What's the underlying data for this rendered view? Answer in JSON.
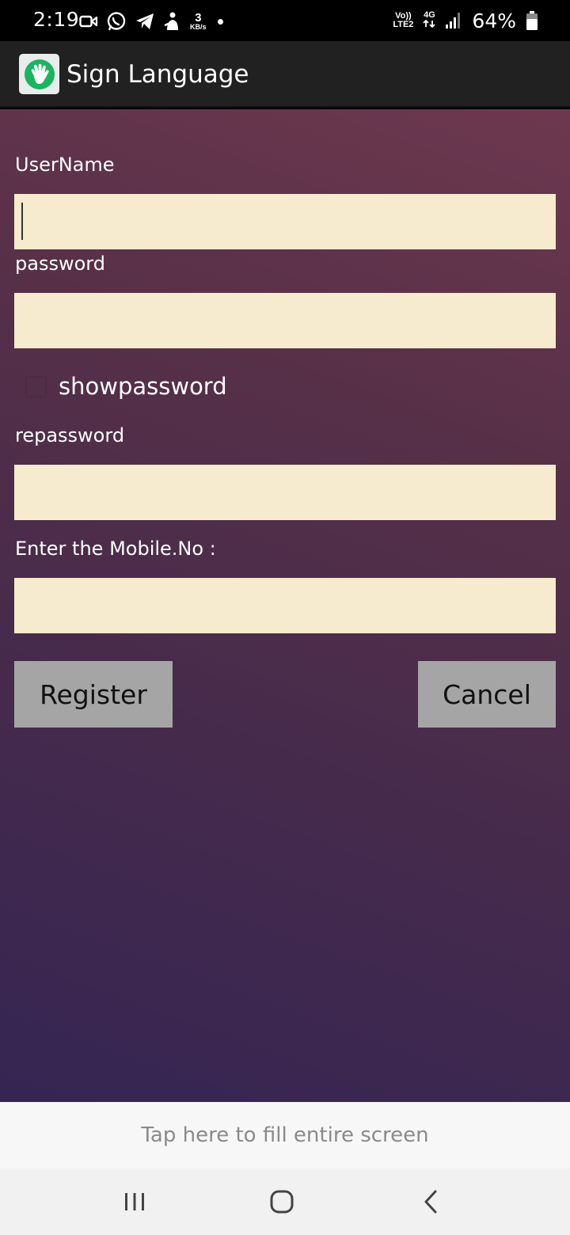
{
  "status_bar": {
    "time": "2:19",
    "speed_value": "3",
    "speed_unit": "KB/s",
    "volte_top": "Vo))",
    "volte_bottom": "LTE2",
    "network": "4G",
    "battery": "64%"
  },
  "app_bar": {
    "title": "Sign Language",
    "logo_icon": "hand-wave-icon",
    "brand_color": "#1db360"
  },
  "form": {
    "username_label": "UserName",
    "username_value": "",
    "password_label": "password",
    "password_value": "",
    "show_password_label": "showpassword",
    "show_password_checked": false,
    "repassword_label": "repassword",
    "repassword_value": "",
    "mobile_label": "Enter the Mobile.No :",
    "mobile_value": "",
    "field_color": "#f6ebce"
  },
  "buttons": {
    "register_label": "Register",
    "cancel_label": "Cancel"
  },
  "banner": {
    "text": "Tap here to fill entire screen"
  },
  "nav": {
    "recents_icon": "recents-icon",
    "home_icon": "home-icon",
    "back_icon": "back-icon"
  }
}
